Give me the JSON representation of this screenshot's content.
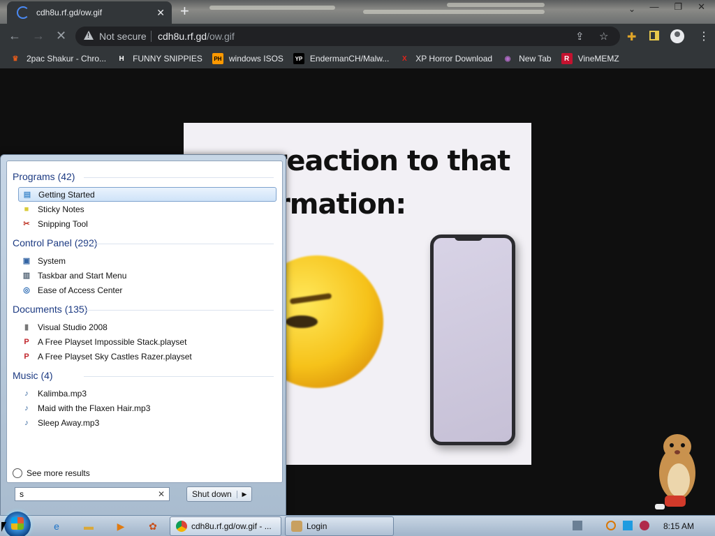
{
  "browser": {
    "tab": {
      "title": "cdh8u.rf.gd/ow.gif",
      "close": "✕"
    },
    "new_tab": "+",
    "omnibox": {
      "security": "Not secure",
      "host": "cdh8u.rf.gd",
      "path": "/ow.gif"
    },
    "bookmarks": [
      {
        "label": "2pac Shakur - Chro...",
        "icon": "2pac-icon",
        "fav_text": "♛",
        "color": "#e05a1c"
      },
      {
        "label": "FUNNY SNIPPIES",
        "icon": "h-icon",
        "fav_text": "H",
        "color": "#ffffff"
      },
      {
        "label": "windows ISOS",
        "icon": "ph-icon",
        "fav_text": "PH",
        "color": "#ff9900"
      },
      {
        "label": "EndermanCH/Malw...",
        "icon": "yp-icon",
        "fav_text": "YP",
        "color": "#222222"
      },
      {
        "label": "XP Horror Download",
        "icon": "x-icon",
        "fav_text": "X",
        "color": "#e2231a"
      },
      {
        "label": "New Tab",
        "icon": "globe-icon",
        "fav_text": "◉",
        "color": "#b26cc8"
      },
      {
        "label": "VineMEMZ",
        "icon": "r-icon",
        "fav_text": "R",
        "color": "#c4122f"
      }
    ]
  },
  "page": {
    "gif_caption": "my reaction to that information:"
  },
  "start_menu": {
    "groups": [
      {
        "title": "Programs (42)",
        "items": [
          {
            "label": "Getting Started",
            "icon": "getting-started-icon",
            "glyph": "▤",
            "color": "#4a8fce",
            "selected": true
          },
          {
            "label": "Sticky Notes",
            "icon": "sticky-notes-icon",
            "glyph": "■",
            "color": "#d9cc3a",
            "selected": false
          },
          {
            "label": "Snipping Tool",
            "icon": "scissors-icon",
            "glyph": "✂",
            "color": "#c0392b",
            "selected": false
          }
        ]
      },
      {
        "title": "Control Panel (292)",
        "items": [
          {
            "label": "System",
            "icon": "system-icon",
            "glyph": "▣",
            "color": "#3465a4",
            "selected": false
          },
          {
            "label": "Taskbar and Start Menu",
            "icon": "taskbar-icon",
            "glyph": "▥",
            "color": "#556677",
            "selected": false
          },
          {
            "label": "Ease of Access Center",
            "icon": "ease-of-access-icon",
            "glyph": "◎",
            "color": "#2a6ab3",
            "selected": false
          }
        ]
      },
      {
        "title": "Documents (135)",
        "items": [
          {
            "label": "Visual Studio 2008",
            "icon": "folder-icon",
            "glyph": "▮",
            "color": "#777777",
            "selected": false
          },
          {
            "label": "A Free Playset Impossible Stack.playset",
            "icon": "playset-icon",
            "glyph": "P",
            "color": "#c1272d",
            "selected": false
          },
          {
            "label": "A Free Playset Sky Castles Razer.playset",
            "icon": "playset-icon",
            "glyph": "P",
            "color": "#c1272d",
            "selected": false
          }
        ]
      },
      {
        "title": "Music (4)",
        "items": [
          {
            "label": "Kalimba.mp3",
            "icon": "music-file-icon",
            "glyph": "♪",
            "color": "#2d5f9a",
            "selected": false
          },
          {
            "label": "Maid with the Flaxen Hair.mp3",
            "icon": "music-file-icon",
            "glyph": "♪",
            "color": "#2d5f9a",
            "selected": false
          },
          {
            "label": "Sleep Away.mp3",
            "icon": "music-file-icon",
            "glyph": "♪",
            "color": "#2d5f9a",
            "selected": false
          }
        ]
      }
    ],
    "see_more": "See more results",
    "search_value": "s",
    "search_clear": "✕",
    "shutdown_label": "Shut down"
  },
  "taskbar": {
    "pinned": [
      {
        "name": "internet-explorer-icon",
        "glyph": "e",
        "color": "#1e74c8"
      },
      {
        "name": "file-explorer-icon",
        "glyph": "▬",
        "color": "#d9a83a"
      },
      {
        "name": "media-player-icon",
        "glyph": "▶",
        "color": "#e07a10"
      },
      {
        "name": "paint-icon",
        "glyph": "✿",
        "color": "#c8501a"
      }
    ],
    "tasks": [
      {
        "label": "cdh8u.rf.gd/ow.gif - ...",
        "icon": "chrome-icon"
      },
      {
        "label": "Login",
        "icon": "login-icon"
      }
    ],
    "clock": "8:15 AM"
  }
}
